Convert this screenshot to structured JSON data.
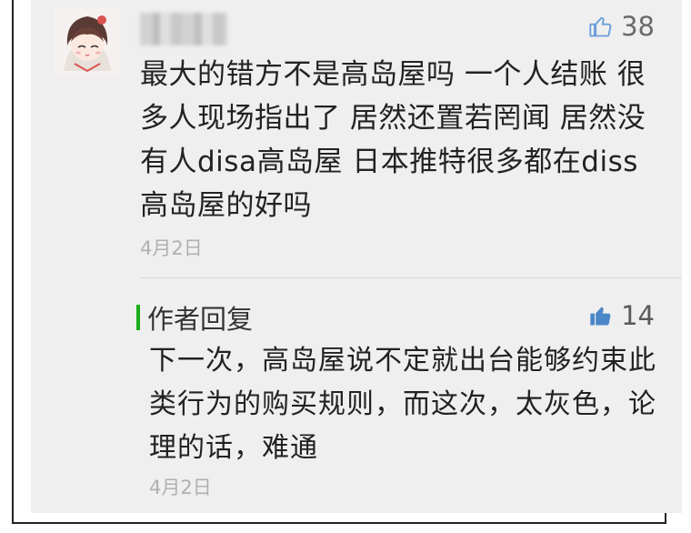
{
  "comment": {
    "text": "最大的错方不是高岛屋吗 一个人结账 很多人现场指出了 居然还置若罔闻 居然没有人disa高岛屋 日本推特很多都在diss高岛屋的好吗",
    "date": "4月2日",
    "like_count": "38",
    "avatar_icon": "anime-girl-avatar",
    "like_icon": "thumbs-up-outline-icon"
  },
  "reply": {
    "label": "作者回复",
    "text": "下一次，高岛屋说不定就出台能够约束此类行为的购买规则，而这次，太灰色，论理的话，难通",
    "date": "4月2日",
    "like_count": "14",
    "like_icon": "thumbs-up-filled-icon",
    "accent_color": "#1aad19"
  }
}
